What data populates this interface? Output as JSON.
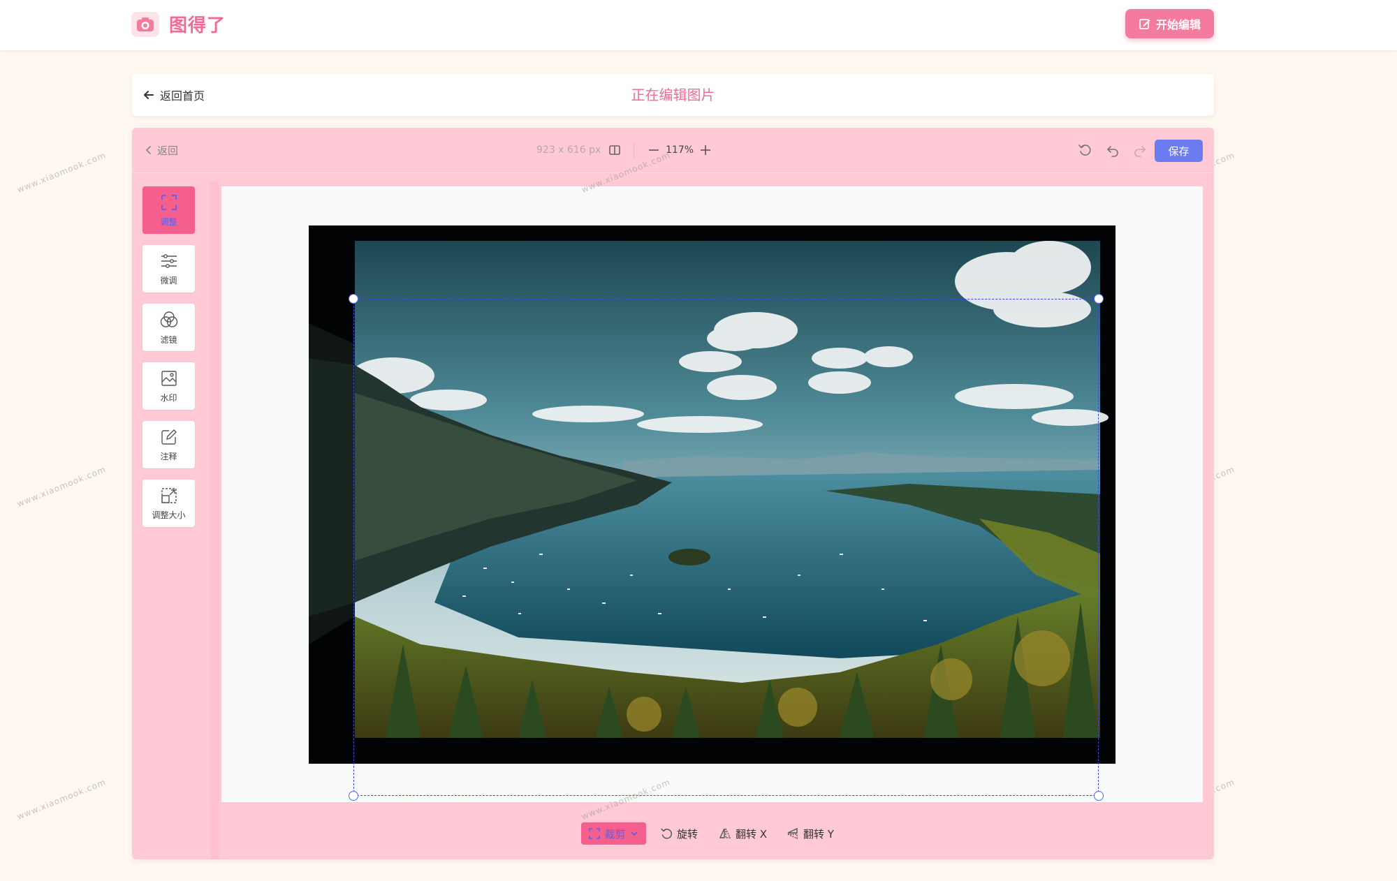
{
  "header": {
    "app_name": "图得了",
    "start_edit_label": "开始编辑"
  },
  "subheader": {
    "back_home_label": "返回首页",
    "page_title": "正在编辑图片"
  },
  "toolbar": {
    "back_label": "返回",
    "image_dims": "923 x 616 px",
    "zoom_level": "117%",
    "save_label": "保存"
  },
  "side_tools": [
    {
      "label": "调整",
      "icon": "crop-frame-icon",
      "active": true
    },
    {
      "label": "微调",
      "icon": "sliders-icon",
      "active": false
    },
    {
      "label": "滤镜",
      "icon": "filter-circles-icon",
      "active": false
    },
    {
      "label": "水印",
      "icon": "watermark-image-icon",
      "active": false
    },
    {
      "label": "注释",
      "icon": "annotate-pen-icon",
      "active": false
    },
    {
      "label": "调整大小",
      "icon": "resize-icon",
      "active": false
    }
  ],
  "bottom_actions": {
    "crop_label": "裁剪",
    "rotate_label": "旋转",
    "flip_x_label": "翻转 X",
    "flip_y_label": "翻转 Y"
  },
  "watermark_text": "www.xiaomook.com",
  "colors": {
    "brand_pink": "#f36b95",
    "panel_pink": "#ffc9d6",
    "active_pink": "#f45f8e",
    "save_blue": "#6b7cf0",
    "page_bg": "#fff8f0"
  }
}
